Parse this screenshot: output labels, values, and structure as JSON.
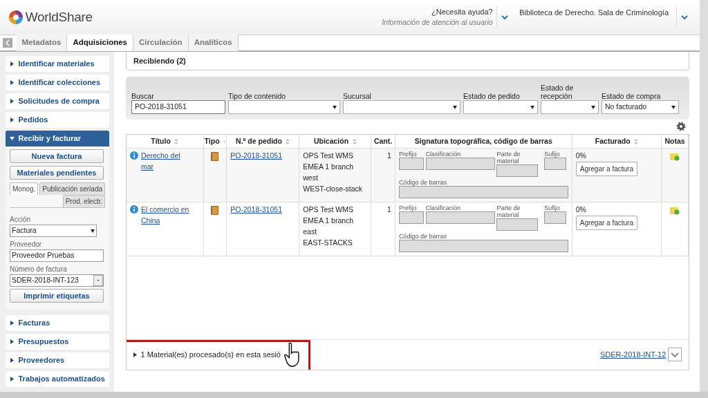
{
  "header": {
    "logo": "WorldShare",
    "help": {
      "label": "¿Necesita ayuda?",
      "sublabel": "Información de atención al usuario"
    },
    "branch": "Biblioteca de Derecho. Sala de Criminología"
  },
  "module_tabs": [
    {
      "label": "Metadatos",
      "selected": false
    },
    {
      "label": "Adquisiciones",
      "selected": true
    },
    {
      "label": "Circulación",
      "selected": false
    },
    {
      "label": "Analíticos",
      "selected": false
    }
  ],
  "sidebar": {
    "items": [
      {
        "label": "Identificar materiales",
        "expanded": false
      },
      {
        "label": "Identificar colecciones",
        "expanded": false
      },
      {
        "label": "Solicitudes de compra",
        "expanded": false
      },
      {
        "label": "Pedidos",
        "expanded": false
      },
      {
        "label": "Recibir y facturar",
        "expanded": true,
        "panel": {
          "buttons": [
            "Nueva factura",
            "Materiales pendientes"
          ],
          "subtabs": [
            {
              "label": "Monog.",
              "selected": true
            },
            {
              "label": "Publicación seriada",
              "selected": false
            },
            {
              "label": "Prod. electr.",
              "selected": false
            }
          ],
          "fields": [
            {
              "label": "Acción",
              "value": "Factura",
              "kind": "select"
            },
            {
              "label": "Proveedor",
              "value": "Proveedor Pruebas",
              "kind": "text"
            },
            {
              "label": "Número de factura",
              "value": "SDER-2018-INT-123",
              "kind": "combo"
            }
          ],
          "print_button": "Imprimir etiquetas"
        }
      },
      {
        "label": "Facturas",
        "expanded": false
      },
      {
        "label": "Presupuestos",
        "expanded": false
      },
      {
        "label": "Proveedores",
        "expanded": false
      },
      {
        "label": "Trabajos automatizados",
        "expanded": false
      }
    ]
  },
  "main": {
    "title": "Recibiendo (2)",
    "filters": [
      {
        "label": "Buscar",
        "value": "PO-2018-31051",
        "kind": "text"
      },
      {
        "label": "Tipo de contenido",
        "kind": "select"
      },
      {
        "label": "Sucursal",
        "kind": "select"
      },
      {
        "label": "Estado de pedido",
        "kind": "select"
      },
      {
        "label": "Estado de recepción",
        "kind": "select"
      },
      {
        "label": "Estado de compra",
        "value": "No facturado",
        "kind": "select"
      }
    ],
    "table": {
      "columns": [
        {
          "label": "Título",
          "sortable": true
        },
        {
          "label": "Tipo",
          "sortable": true
        },
        {
          "label": "N.º de pedido",
          "sortable": true
        },
        {
          "label": "Ubicación",
          "sortable": true
        },
        {
          "label": "Cant.",
          "sortable": false
        },
        {
          "label": "Signatura topográfica, código de barras",
          "sortable": false
        },
        {
          "label": "Facturado",
          "sortable": true
        },
        {
          "label": "Notas",
          "sortable": false
        }
      ],
      "rows": [
        {
          "title": "Derecho del mar",
          "order": "PO-2018-31051",
          "location": [
            "OPS Test WMS",
            "EMEA 1 branch",
            "west",
            "WEST-close-stack"
          ],
          "qty": "1",
          "call": {
            "prefix": "Prefijo",
            "classification": "Clasificación",
            "item_part": "Parte de material",
            "suffix": "Sufijo",
            "barcode": "Código de barras"
          },
          "invoiced": "0%",
          "action": "Agregar a factura"
        },
        {
          "title": "El comercio en China",
          "order": "PO-2018-31051",
          "location": [
            "OPS Test WMS",
            "EMEA 1 branch",
            "east",
            "EAST-STACKS"
          ],
          "qty": "1",
          "call": {
            "prefix": "Prefijo",
            "classification": "Clasificación",
            "item_part": "Parte de material",
            "suffix": "Sufijo",
            "barcode": "Código de barras"
          },
          "invoiced": "0%",
          "action": "Agregar a factura"
        }
      ]
    },
    "footer": {
      "summary": "1 Material(es) procesado(s) en esta sesió",
      "invoice_link": "SDER-2018-INT-12"
    }
  }
}
